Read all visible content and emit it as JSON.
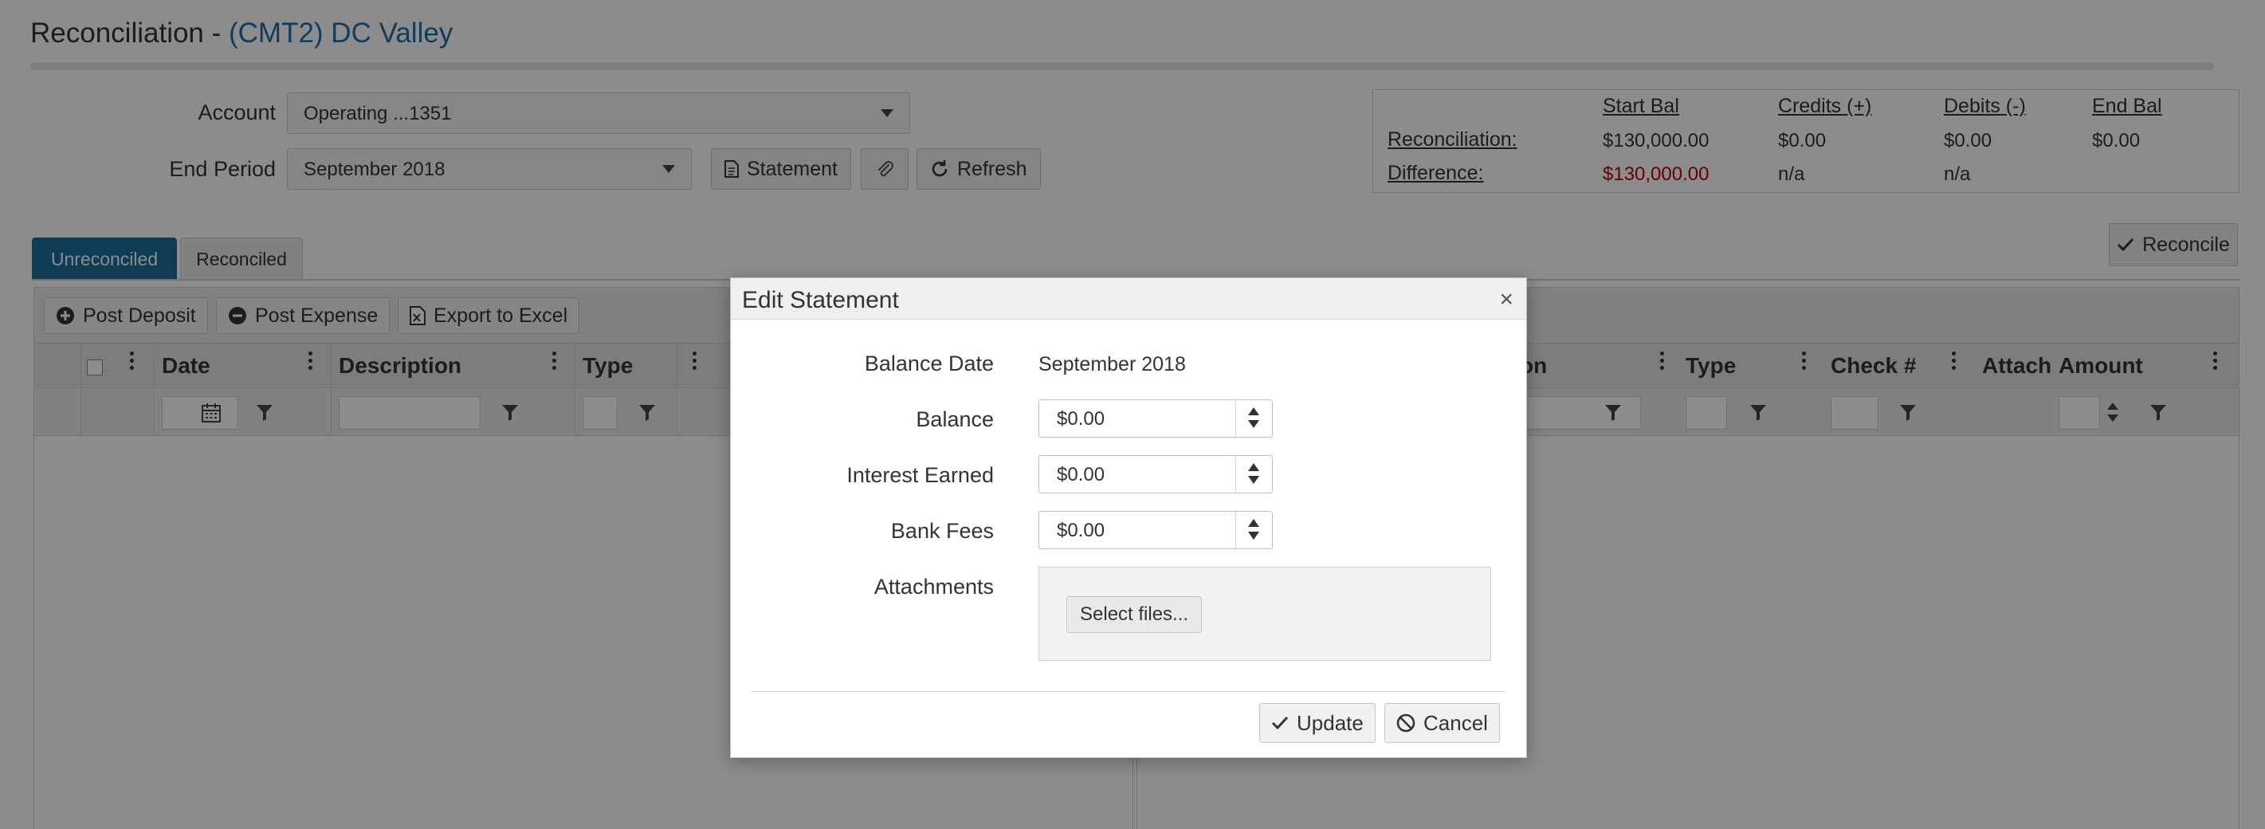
{
  "page": {
    "title_prefix": "Reconciliation - ",
    "title_account": "(CMT2) DC Valley"
  },
  "filters": {
    "account_label": "Account",
    "account_value": "Operating ...1351",
    "end_period_label": "End Period",
    "end_period_value": "September 2018",
    "statement_button": "Statement",
    "attach_icon": "paperclip-icon",
    "refresh_button": "Refresh"
  },
  "summary": {
    "headers": [
      "Start Bal",
      "Credits (+)",
      "Debits (-)",
      "End Bal"
    ],
    "rows": [
      {
        "label": "Reconciliation:",
        "values": [
          "$130,000.00",
          "$0.00",
          "$0.00",
          "$0.00"
        ]
      },
      {
        "label": "Difference:",
        "values": [
          "$130,000.00",
          "n/a",
          "n/a"
        ]
      }
    ],
    "negative_color": "#c00000"
  },
  "reconcile_button": "Reconcile",
  "tabs": [
    {
      "label": "Unreconciled",
      "active": true
    },
    {
      "label": "Reconciled",
      "active": false
    }
  ],
  "left_grid": {
    "toolbar": [
      "Post Deposit",
      "Post Expense",
      "Export to Excel"
    ],
    "columns": [
      "Date",
      "Description",
      "Type"
    ]
  },
  "right_grid": {
    "columns": [
      "Type",
      "Check #",
      "Attach",
      "Amount"
    ],
    "partial_column": "on"
  },
  "modal": {
    "title": "Edit Statement",
    "close": "×",
    "balance_date_label": "Balance Date",
    "balance_date_value": "September 2018",
    "balance_label": "Balance",
    "balance_value": "$0.00",
    "interest_label": "Interest Earned",
    "interest_value": "$0.00",
    "fees_label": "Bank Fees",
    "fees_value": "$0.00",
    "attachments_label": "Attachments",
    "select_files": "Select files...",
    "update_button": "Update",
    "cancel_button": "Cancel"
  },
  "colors": {
    "accent": "#1a6e9c",
    "link": "#1f6fa6"
  }
}
